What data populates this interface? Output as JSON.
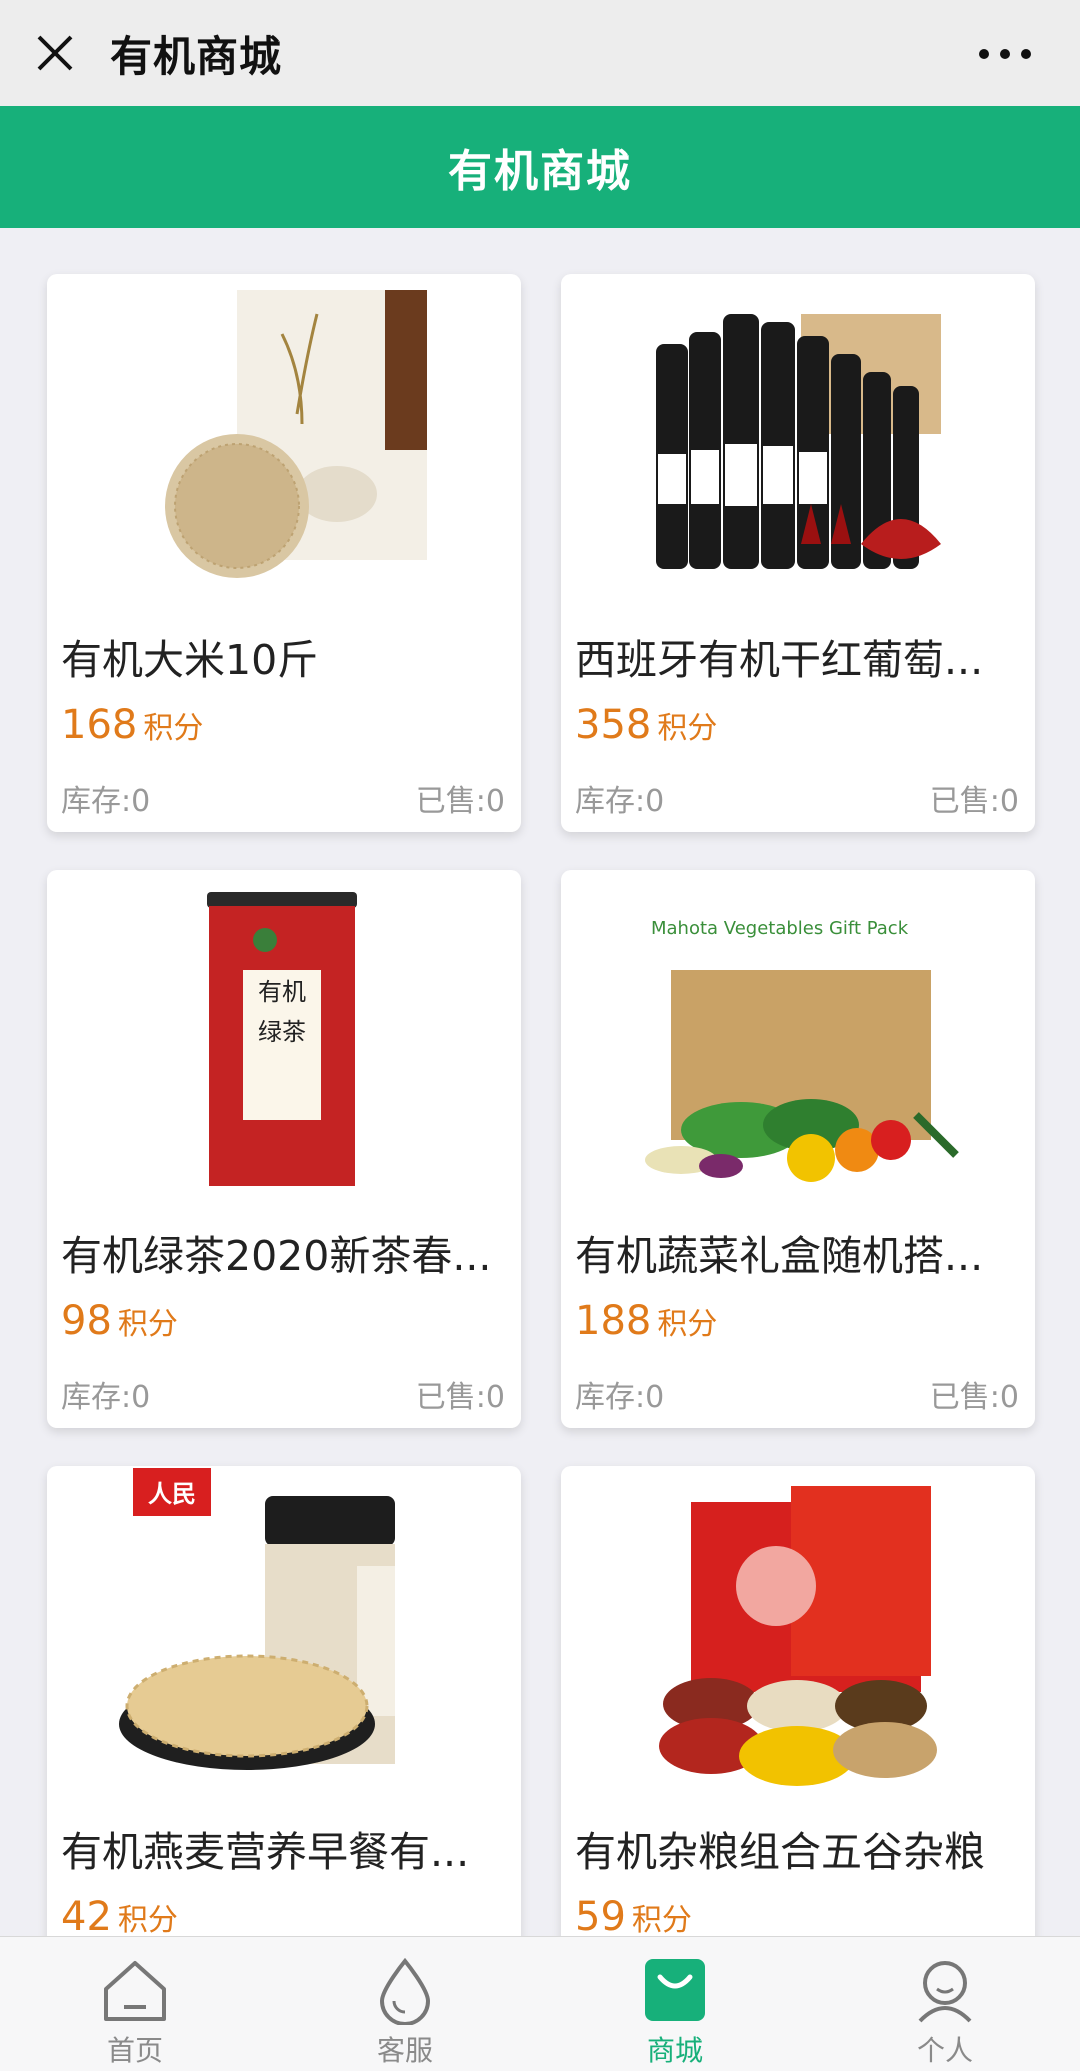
{
  "topbar": {
    "title": "有机商城"
  },
  "header": {
    "title": "有机商城"
  },
  "products": [
    {
      "name": "有机大米10斤",
      "price": "168",
      "unit": "积分",
      "stock": "库存:0",
      "sold": "已售:0",
      "image": "rice-bag"
    },
    {
      "name": "西班牙有机干红葡萄...",
      "price": "358",
      "unit": "积分",
      "stock": "库存:0",
      "sold": "已售:0",
      "image": "wine-set"
    },
    {
      "name": "有机绿茶2020新茶春...",
      "price": "98",
      "unit": "积分",
      "stock": "库存:0",
      "sold": "已售:0",
      "image": "tea-can",
      "image_text": "有机绿茶"
    },
    {
      "name": "有机蔬菜礼盒随机搭...",
      "price": "188",
      "unit": "积分",
      "stock": "库存:0",
      "sold": "已售:0",
      "image": "vegetable-box",
      "image_text": "Mahota Vegetables Gift Pack"
    },
    {
      "name": "有机燕麦营养早餐有...",
      "price": "42",
      "unit": "积分",
      "image": "oatmeal",
      "image_text": "人民"
    },
    {
      "name": "有机杂粮组合五谷杂粮",
      "price": "59",
      "unit": "积分",
      "image": "grain-giftbox"
    }
  ],
  "tabbar": {
    "items": [
      {
        "label": "首页",
        "icon": "home-icon",
        "active": false
      },
      {
        "label": "客服",
        "icon": "droplet-icon",
        "active": false
      },
      {
        "label": "商城",
        "icon": "shopping-bag-icon",
        "active": true
      },
      {
        "label": "个人",
        "icon": "person-icon",
        "active": false
      }
    ]
  },
  "colors": {
    "accent": "#17b07a",
    "price": "#e07a1a"
  }
}
